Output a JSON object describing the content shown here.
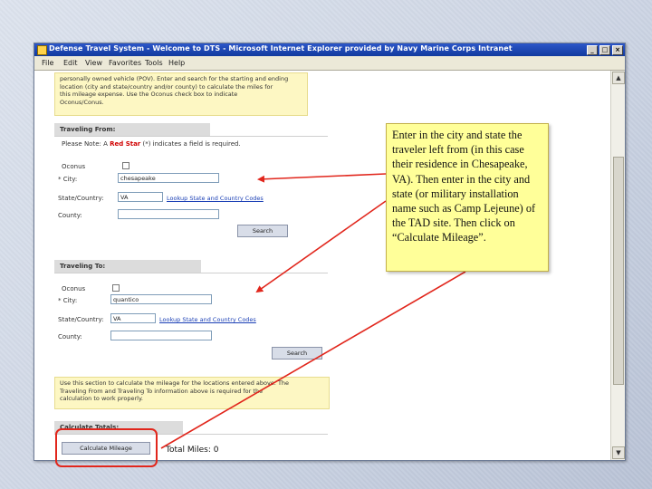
{
  "window": {
    "title": "Defense Travel System - Welcome to DTS - Microsoft Internet Explorer provided by Navy Marine Corps Intranet",
    "controls": [
      "_",
      "□",
      "×"
    ],
    "menu": [
      "File",
      "Edit",
      "View",
      "Favorites",
      "Tools",
      "Help"
    ]
  },
  "top_note": {
    "lines": [
      "personally owned vehicle (POV). Enter and search for the starting and ending",
      "location (city and state/country and/or county) to calculate the miles for",
      "this mileage expense. Use the Oconus check box to indicate",
      "Oconus/Conus."
    ]
  },
  "traveling_from": {
    "heading": "Traveling From:",
    "please_note_prefix": "Please Note: A ",
    "please_note_red": "Red Star",
    "please_note_suffix": " (*) indicates a field is required.",
    "oconus_label": "Oconus",
    "city_label": "* City:",
    "city_value": "chesapeake",
    "state_label": "State/Country:",
    "state_value": "VA",
    "lookup_link": "Lookup State and Country Codes",
    "county_label": "County:",
    "county_value": "",
    "search_button": "Search"
  },
  "traveling_to": {
    "heading": "Traveling To:",
    "oconus_label": "Oconus",
    "city_label": "* City:",
    "city_value": "quantico",
    "state_label": "State/Country:",
    "state_value": "VA",
    "lookup_link": "Lookup State and Country Codes",
    "county_label": "County:",
    "county_value": "",
    "search_button": "Search"
  },
  "calc_note": {
    "lines": [
      "Use this section to calculate the mileage for the locations entered above. The",
      "Traveling From and Traveling To information above is required for the",
      "calculation to work properly."
    ]
  },
  "calculate": {
    "heading": "Calculate Totals:",
    "button": "Calculate Mileage",
    "total_label": "Total Miles:",
    "total_value": "0"
  },
  "callout": {
    "text": "Enter in the city and state the traveler left from (in this case their residence in Chesapeake, VA).  Then enter in the city and state (or military installation name such as Camp Lejeune) of the TAD site.  Then click on “Calculate Mileage”."
  },
  "colors": {
    "callout_bg": "#ffff99",
    "arrow": "#e1261c",
    "highlight": "#e1261c",
    "titlebar": "#1c46b6"
  }
}
